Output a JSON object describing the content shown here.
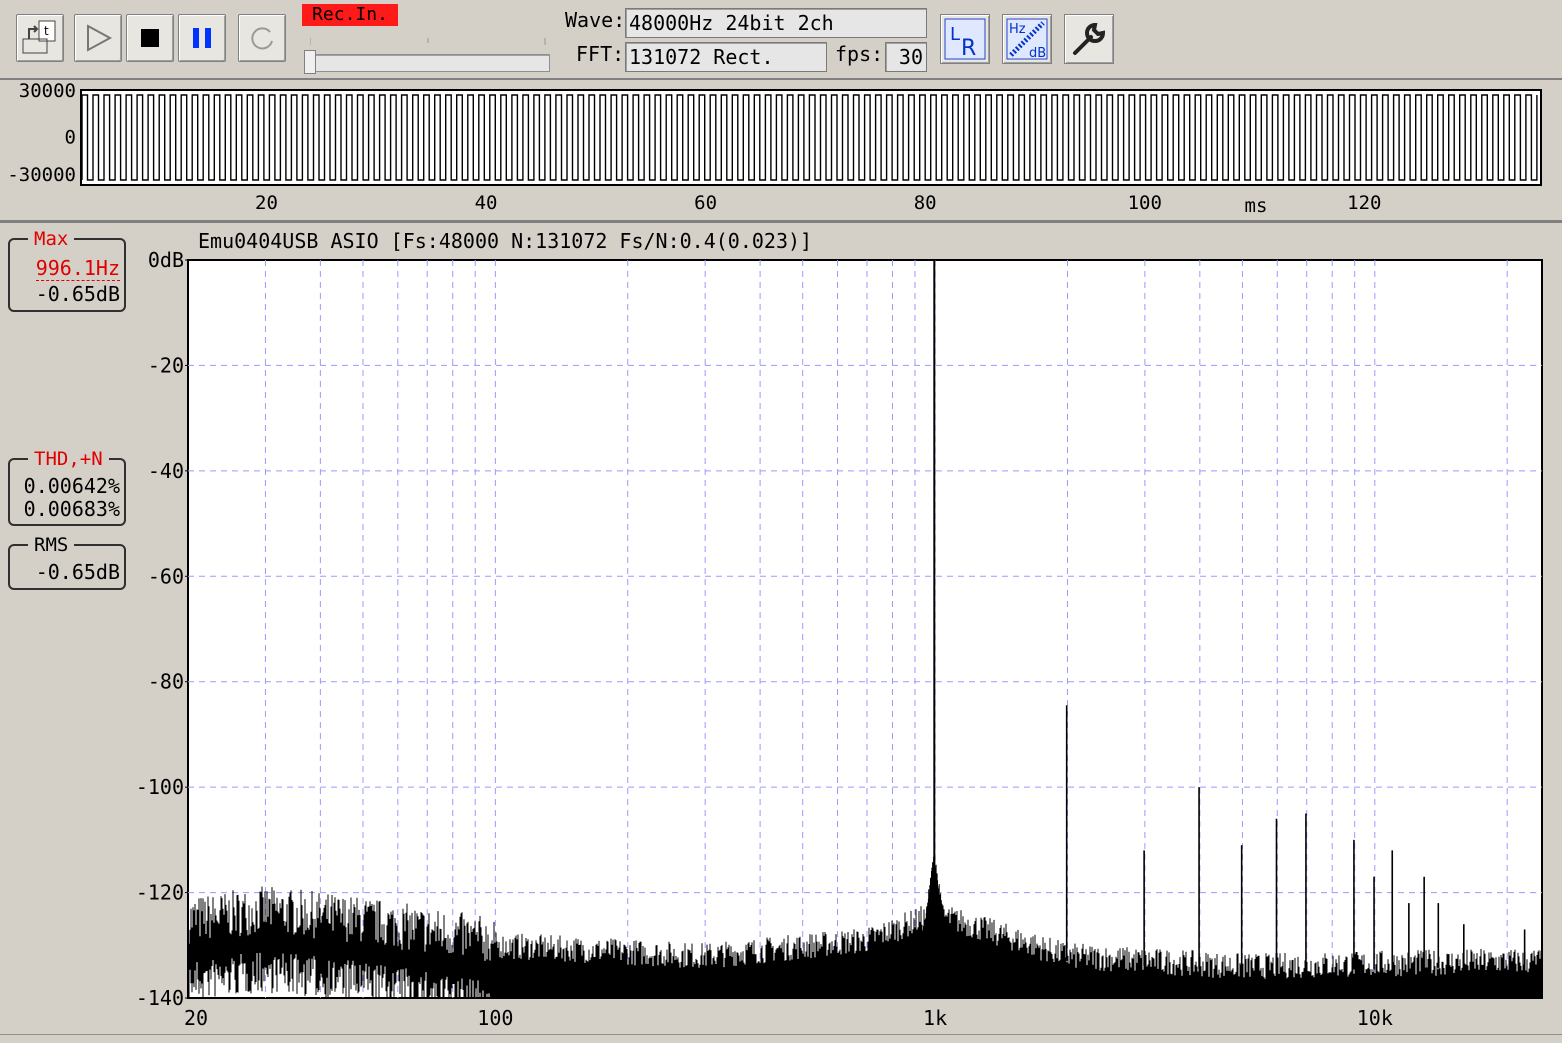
{
  "toolbar": {
    "rec_badge": "Rec.In.",
    "wave_label": "Wave:",
    "wave_value": "48000Hz 24bit 2ch",
    "fft_label": "FFT:",
    "fft_value": "131072 Rect.",
    "fps_label": "fps:",
    "fps_value": "30",
    "buttons": [
      {
        "name": "load-button",
        "icon": "open-file-icon"
      },
      {
        "name": "play-button",
        "icon": "play-icon"
      },
      {
        "name": "stop-button",
        "icon": "stop-icon"
      },
      {
        "name": "pause-button",
        "icon": "pause-icon"
      },
      {
        "name": "loop-button",
        "icon": "loop-icon"
      }
    ],
    "icon_buttons": [
      {
        "name": "lr-channel-button",
        "icon": "lr-icon",
        "text1": "L",
        "text2": "R"
      },
      {
        "name": "hz-db-scale-button",
        "icon": "hz-db-icon",
        "text1": "Hz",
        "text2": "dB"
      },
      {
        "name": "settings-button",
        "icon": "wrench-icon"
      }
    ]
  },
  "waveform": {
    "y_ticks": [
      "30000",
      "0",
      "-30000"
    ],
    "x_ticks": [
      "20",
      "40",
      "60",
      "80",
      "100",
      "120"
    ],
    "x_unit": "ms",
    "amplitude": 30000,
    "frequency_hz": 996.1,
    "duration_ms": 136
  },
  "spectrum": {
    "header": "Emu0404USB ASIO  [Fs:48000 N:131072 Fs/N:0.4(0.023)]",
    "y_ticks": [
      "0dB",
      "-20",
      "-40",
      "-60",
      "-80",
      "-100",
      "-120",
      "-140"
    ],
    "x_ticks": [
      "20",
      "100",
      "1k",
      "10k"
    ],
    "max": {
      "title": "Max",
      "freq": "996.1Hz",
      "level": "-0.65dB"
    },
    "thd": {
      "title": "THD,+N",
      "thd": "0.00642%",
      "thdn": "0.00683%"
    },
    "rms": {
      "title": "RMS",
      "level": "-0.65dB"
    }
  },
  "chart_data": {
    "type": "line",
    "x_scale": "log",
    "xlim": [
      20,
      24000
    ],
    "ylim": [
      -140,
      0
    ],
    "grid": true,
    "peaks": [
      {
        "freq": 996,
        "db": 0
      },
      {
        "freq": 1992,
        "db": -84.5
      },
      {
        "freq": 2988,
        "db": -112
      },
      {
        "freq": 3984,
        "db": -100
      },
      {
        "freq": 4980,
        "db": -111
      },
      {
        "freq": 5976,
        "db": -106
      },
      {
        "freq": 6972,
        "db": -105
      },
      {
        "freq": 8964,
        "db": -110
      },
      {
        "freq": 9960,
        "db": -117
      },
      {
        "freq": 10956,
        "db": -112
      },
      {
        "freq": 11952,
        "db": -122
      },
      {
        "freq": 12948,
        "db": -117
      },
      {
        "freq": 13944,
        "db": -122
      },
      {
        "freq": 15936,
        "db": -126
      },
      {
        "freq": 21912,
        "db": -127
      }
    ],
    "noise_floor_db": [
      {
        "freq": 20,
        "db": -127
      },
      {
        "freq": 30,
        "db": -125
      },
      {
        "freq": 50,
        "db": -127
      },
      {
        "freq": 100,
        "db": -131
      },
      {
        "freq": 300,
        "db": -133
      },
      {
        "freq": 700,
        "db": -130
      },
      {
        "freq": 1000,
        "db": -125
      },
      {
        "freq": 2000,
        "db": -133
      },
      {
        "freq": 5000,
        "db": -135
      },
      {
        "freq": 20000,
        "db": -134
      }
    ]
  }
}
